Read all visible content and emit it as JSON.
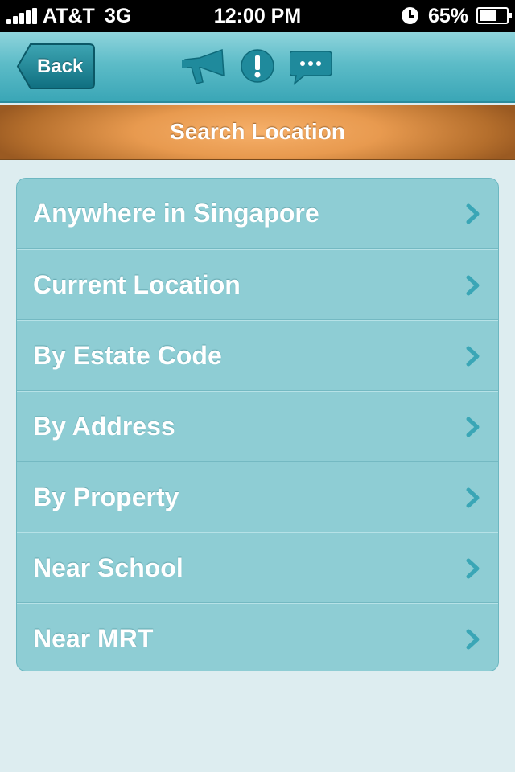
{
  "status_bar": {
    "carrier": "AT&T",
    "network": "3G",
    "time": "12:00 PM",
    "battery": "65%",
    "battery_level": 0.65
  },
  "nav_bar": {
    "back_label": "Back",
    "icons": [
      "megaphone-icon",
      "alert-icon",
      "chat-icon"
    ],
    "accent_color": "#5dbcc8"
  },
  "title_bar": {
    "title": "Search Location",
    "color": "#e89a4f"
  },
  "menu": {
    "items": [
      {
        "label": "Anywhere in Singapore"
      },
      {
        "label": "Current Location"
      },
      {
        "label": "By Estate Code"
      },
      {
        "label": "By Address"
      },
      {
        "label": "By Property"
      },
      {
        "label": "Near School"
      },
      {
        "label": "Near MRT"
      }
    ],
    "background_color": "#8ecdd4",
    "chevron_color": "#3aa6b6"
  }
}
